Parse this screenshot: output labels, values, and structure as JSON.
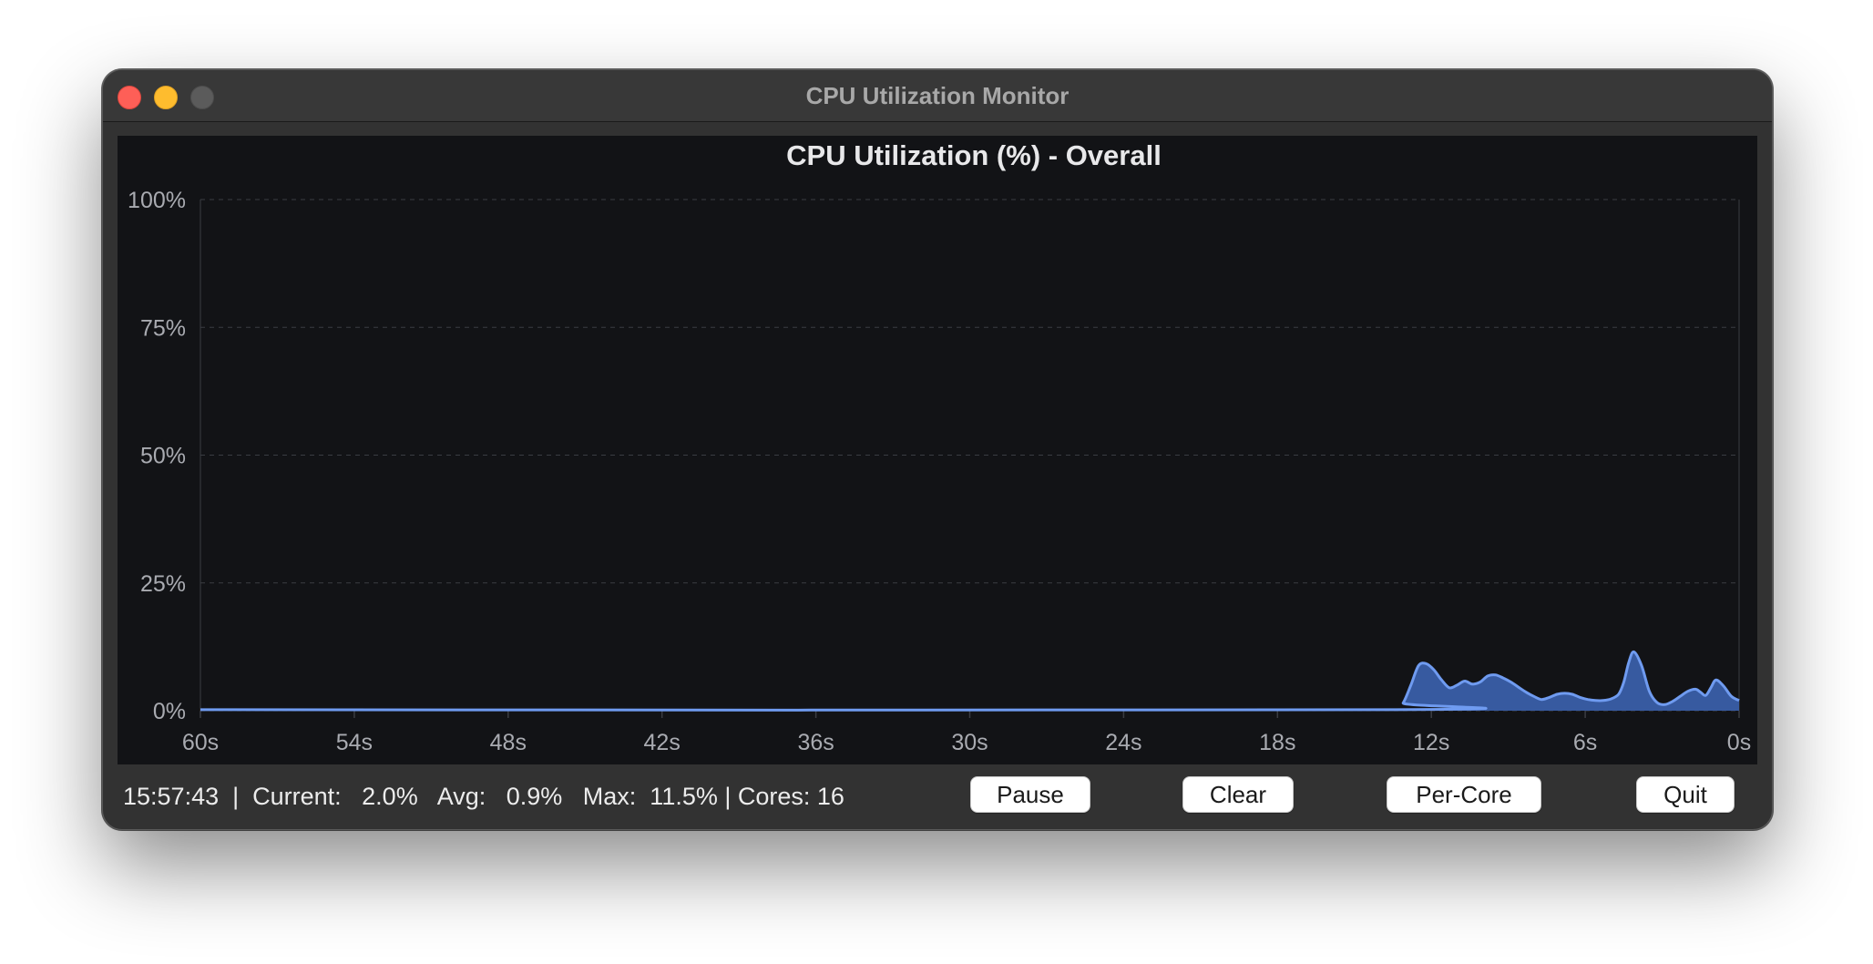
{
  "window": {
    "title": "CPU Utilization Monitor"
  },
  "colors": {
    "line": "#6f9bf0",
    "fill": "#3a5ea8",
    "background": "#121316",
    "grid": "#3a3c42",
    "tick_text": "#a9abb1",
    "title_text": "#e8e8ea"
  },
  "chart_data": {
    "type": "area",
    "title": "CPU Utilization (%) - Overall",
    "xlabel": "",
    "ylabel": "",
    "xlim": [
      60,
      0
    ],
    "ylim": [
      0,
      100
    ],
    "grid": true,
    "xticks": [
      "60s",
      "54s",
      "48s",
      "42s",
      "36s",
      "30s",
      "24s",
      "18s",
      "12s",
      "6s",
      "0s"
    ],
    "yticks": [
      "0%",
      "25%",
      "50%",
      "75%",
      "100%"
    ],
    "series": [
      {
        "x": [
          60,
          13.4,
          13.1,
          12.8,
          12.5,
          12.2,
          11.9,
          11.6,
          11.3,
          11.0,
          10.7,
          10.4,
          10.1,
          9.8,
          9.5,
          9.2,
          8.9,
          8.6,
          8.3,
          8.0,
          7.7,
          7.4,
          7.1,
          6.8,
          6.5,
          6.2,
          5.9,
          5.6,
          5.3,
          5.0,
          4.7,
          4.5,
          4.3,
          4.1,
          3.8,
          3.5,
          3.2,
          2.9,
          2.6,
          2.3,
          2.0,
          1.7,
          1.5,
          1.3,
          1.1,
          0.9,
          0.6,
          0.3,
          0.0
        ],
        "y": [
          0.2,
          0.2,
          1.5,
          5.0,
          8.8,
          9.2,
          8.0,
          6.0,
          4.5,
          5.0,
          5.8,
          5.2,
          5.6,
          6.8,
          7.0,
          6.4,
          5.6,
          4.6,
          3.6,
          2.8,
          2.2,
          2.6,
          3.2,
          3.4,
          3.2,
          2.6,
          2.2,
          2.0,
          2.0,
          2.3,
          3.2,
          5.5,
          9.5,
          11.5,
          8.8,
          3.8,
          1.6,
          1.2,
          1.8,
          2.8,
          3.8,
          4.2,
          3.6,
          3.0,
          4.5,
          6.0,
          4.8,
          2.8,
          2.0
        ]
      }
    ]
  },
  "status": {
    "text": "15:57:43  |  Current:   2.0%   Avg:   0.9%   Max:  11.5% | Cores: 16"
  },
  "buttons": {
    "pause": "Pause",
    "clear": "Clear",
    "per_core": "Per-Core",
    "quit": "Quit"
  }
}
